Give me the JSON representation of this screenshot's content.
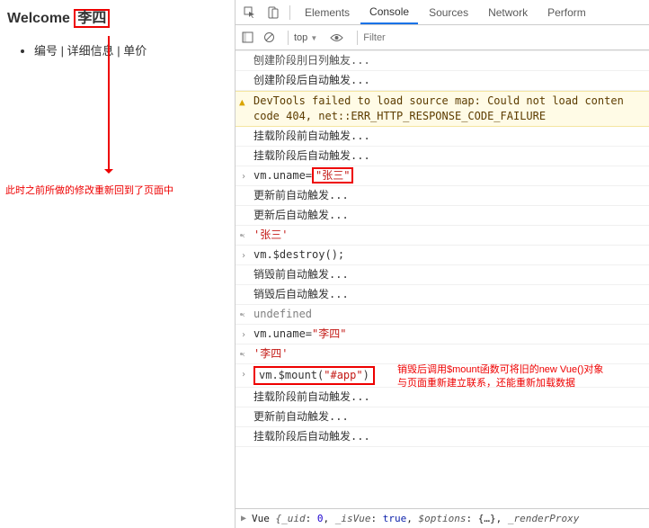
{
  "page": {
    "welcome_prefix": "Welcome",
    "uname": "李四",
    "cols": [
      "编号",
      "详细信息",
      "单价"
    ]
  },
  "annotations": {
    "a1": "此时之前所做的修改重新回到了页面中",
    "a2_l1": "销毁后调用$mount函数可将旧的new Vue()对象",
    "a2_l2": "与页面重新建立联系，还能重新加载数据"
  },
  "devtools": {
    "tabs": [
      "Elements",
      "Console",
      "Sources",
      "Network",
      "Perform"
    ],
    "active_tab": 1,
    "context": "top",
    "filter_placeholder": "Filter",
    "logs": [
      {
        "t": "plain",
        "text": "创建阶段前自动触发...",
        "cut": true
      },
      {
        "t": "plain",
        "text": "创建阶段后自动触发..."
      },
      {
        "t": "warn",
        "text": "DevTools failed to load source map: Could not load conten code 404, net::ERR_HTTP_RESPONSE_CODE_FAILURE"
      },
      {
        "t": "plain",
        "text": "挂载阶段前自动触发..."
      },
      {
        "t": "plain",
        "text": "挂载阶段后自动触发..."
      },
      {
        "t": "input",
        "text": "vm.uname=",
        "str": "\"张三\"",
        "box": "str"
      },
      {
        "t": "plain",
        "text": "更新前自动触发..."
      },
      {
        "t": "plain",
        "text": "更新后自动触发..."
      },
      {
        "t": "return",
        "str": "'张三'"
      },
      {
        "t": "input",
        "text": "vm.$destroy();"
      },
      {
        "t": "plain",
        "text": "销毁前自动触发..."
      },
      {
        "t": "plain",
        "text": "销毁后自动触发..."
      },
      {
        "t": "undef",
        "text": "undefined"
      },
      {
        "t": "input",
        "text": "vm.uname=",
        "str": "\"李四\""
      },
      {
        "t": "return",
        "str": "'李四'"
      },
      {
        "t": "input",
        "text": "vm.$mount(",
        "str": "\"#app\"",
        "tail": ")",
        "box": "all",
        "anno": true
      },
      {
        "t": "plain",
        "text": "挂载阶段前自动触发..."
      },
      {
        "t": "plain",
        "text": "更新前自动触发..."
      },
      {
        "t": "plain",
        "text": "挂载阶段后自动触发..."
      }
    ],
    "status": "Vue {_uid: 0, _isVue: true, $options: {…}, _renderProxy"
  }
}
